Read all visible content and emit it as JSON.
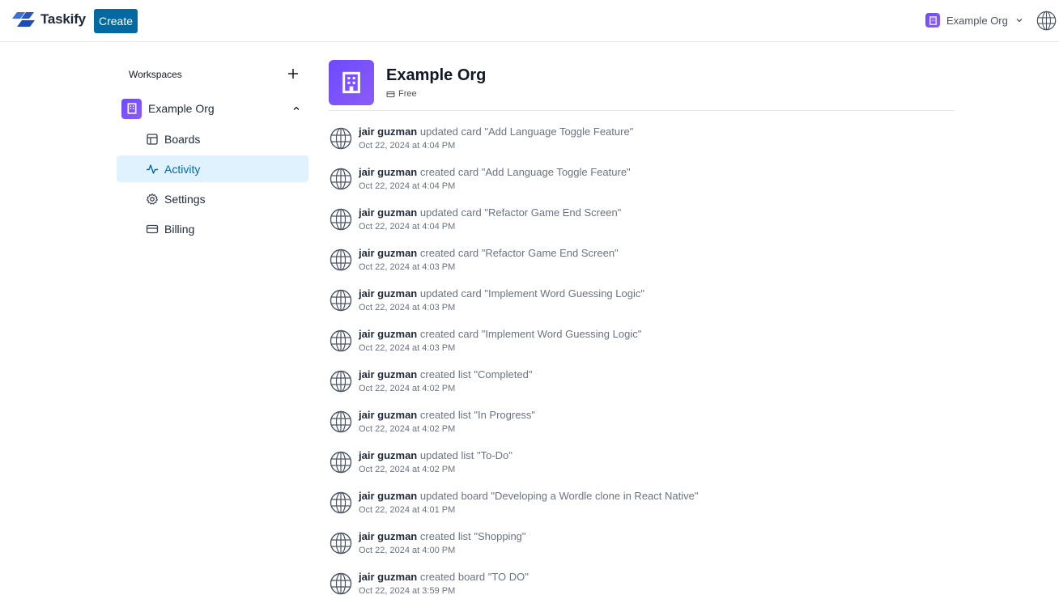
{
  "app": {
    "name": "Taskify",
    "create_label": "Create"
  },
  "org_switcher": {
    "label": "Example Org"
  },
  "sidebar": {
    "workspaces_label": "Workspaces",
    "org_name": "Example Org",
    "items": [
      {
        "label": "Boards",
        "icon": "layout-icon"
      },
      {
        "label": "Activity",
        "icon": "activity-icon",
        "active": true
      },
      {
        "label": "Settings",
        "icon": "settings-icon"
      },
      {
        "label": "Billing",
        "icon": "credit-card-icon"
      }
    ]
  },
  "main": {
    "org_title": "Example Org",
    "plan": "Free",
    "activities": [
      {
        "user": "jair guzman",
        "action": "updated card \"Add Language Toggle Feature\"",
        "time": "Oct 22, 2024 at 4:04 PM"
      },
      {
        "user": "jair guzman",
        "action": "created card \"Add Language Toggle Feature\"",
        "time": "Oct 22, 2024 at 4:04 PM"
      },
      {
        "user": "jair guzman",
        "action": "updated card \"Refactor Game End Screen\"",
        "time": "Oct 22, 2024 at 4:04 PM"
      },
      {
        "user": "jair guzman",
        "action": "created card \"Refactor Game End Screen\"",
        "time": "Oct 22, 2024 at 4:03 PM"
      },
      {
        "user": "jair guzman",
        "action": "updated card \"Implement Word Guessing Logic\"",
        "time": "Oct 22, 2024 at 4:03 PM"
      },
      {
        "user": "jair guzman",
        "action": "created card \"Implement Word Guessing Logic\"",
        "time": "Oct 22, 2024 at 4:03 PM"
      },
      {
        "user": "jair guzman",
        "action": "created list \"Completed\"",
        "time": "Oct 22, 2024 at 4:02 PM"
      },
      {
        "user": "jair guzman",
        "action": "created list \"In Progress\"",
        "time": "Oct 22, 2024 at 4:02 PM"
      },
      {
        "user": "jair guzman",
        "action": "updated list \"To-Do\"",
        "time": "Oct 22, 2024 at 4:02 PM"
      },
      {
        "user": "jair guzman",
        "action": "updated board \"Developing a Wordle clone in React Native\"",
        "time": "Oct 22, 2024 at 4:01 PM"
      },
      {
        "user": "jair guzman",
        "action": "created list \"Shopping\"",
        "time": "Oct 22, 2024 at 4:00 PM"
      },
      {
        "user": "jair guzman",
        "action": "created board \"TO DO\"",
        "time": "Oct 22, 2024 at 3:59 PM"
      }
    ]
  },
  "colors": {
    "brand": "#0369a1",
    "active_bg": "#e0f2fe",
    "org_accent": "#6d4aff"
  }
}
